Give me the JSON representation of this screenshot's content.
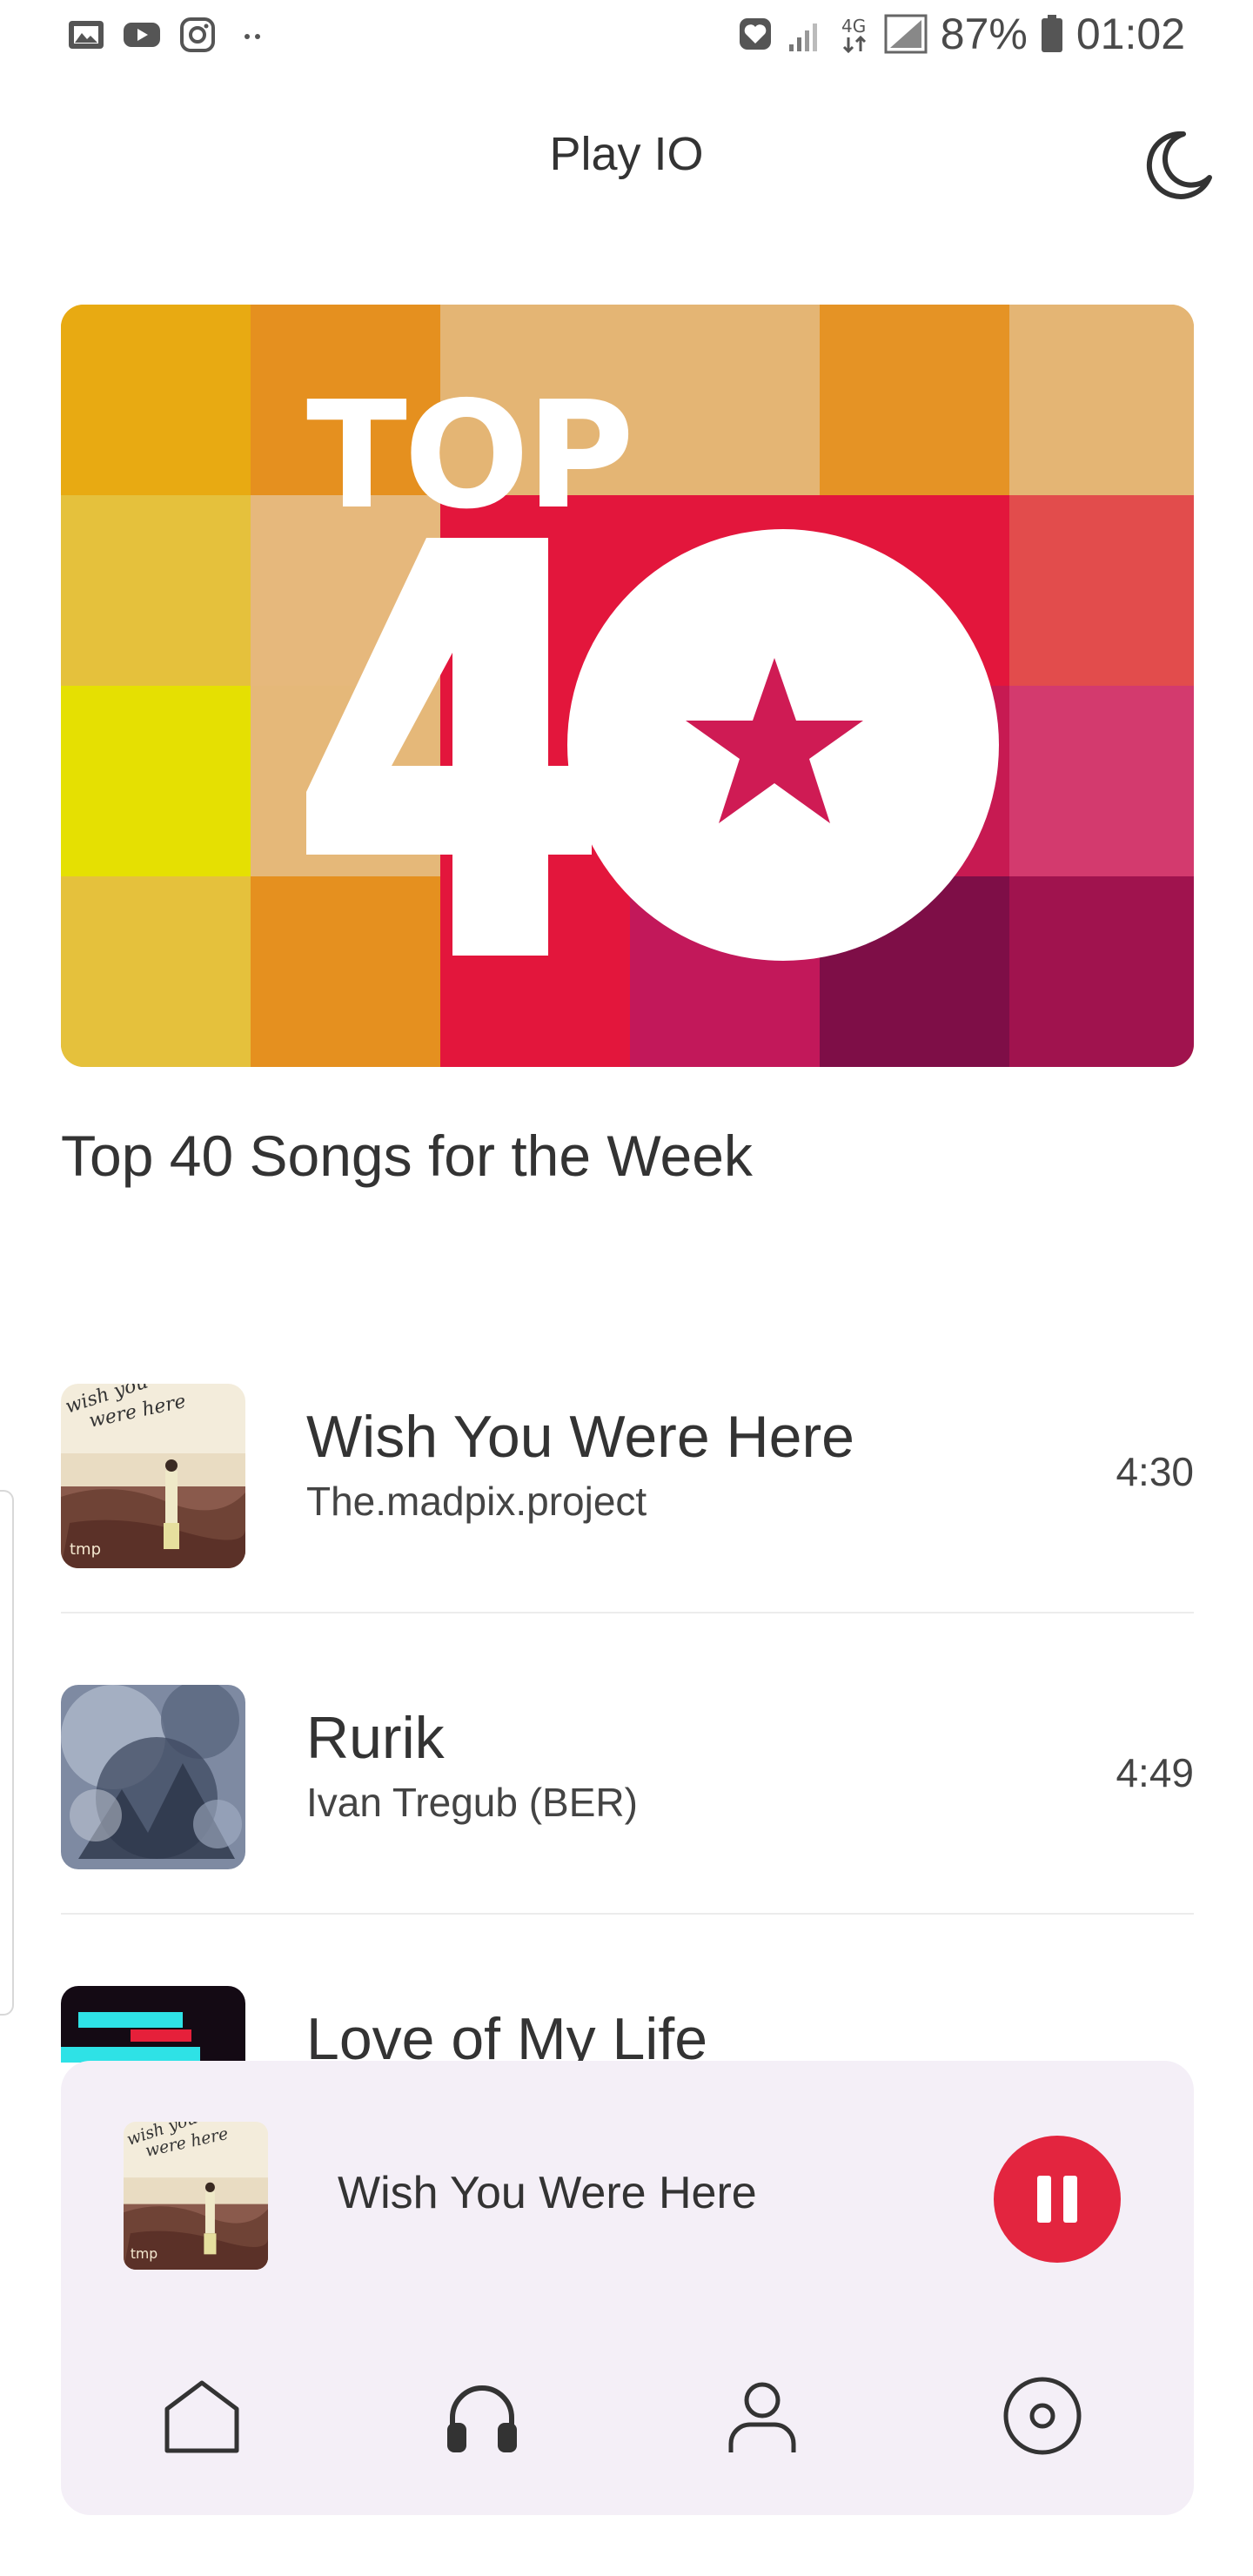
{
  "status_bar": {
    "battery": "87%",
    "time": "01:02",
    "network": "4G"
  },
  "app": {
    "title": "Play IO"
  },
  "playlist": {
    "banner_text_top": "TOP",
    "banner_text_number": "40",
    "title": "Top 40 Songs for the Week"
  },
  "tracks": [
    {
      "title": "Wish You Were Here",
      "artist": "The.madpix.project",
      "duration": "4:30",
      "art_caption_1": "wish you",
      "art_caption_2": "were here",
      "art_mark": "tmp"
    },
    {
      "title": "Rurik",
      "artist": "Ivan Tregub (BER)",
      "duration": "4:49"
    },
    {
      "title": "Love of My Life",
      "artist": "",
      "duration": ""
    }
  ],
  "now_playing": {
    "title": "Wish You Were Here",
    "art_caption_1": "wish you",
    "art_caption_2": "were here",
    "art_mark": "tmp"
  },
  "bottom_nav": {
    "items": [
      "home-icon",
      "headphones-icon",
      "person-icon",
      "disc-icon"
    ]
  },
  "colors": {
    "accent": "#e3253f",
    "player_bg": "#f4eff7",
    "text": "#333333"
  }
}
